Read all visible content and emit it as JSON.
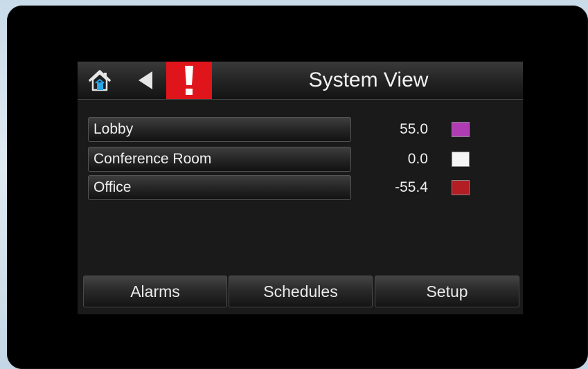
{
  "header": {
    "title": "System View",
    "home_icon": "home-icon",
    "back_icon": "back-arrow-icon",
    "alert_icon": "exclamation-alert-icon",
    "alert_color": "#e0151c"
  },
  "zones": [
    {
      "name": "Lobby",
      "value": "55.0",
      "color": "#b03cb3"
    },
    {
      "name": "Conference Room",
      "value": "0.0",
      "color": "#f5f5f5"
    },
    {
      "name": "Office",
      "value": "-55.4",
      "color": "#b31d24"
    }
  ],
  "footer": {
    "alarms_label": "Alarms",
    "schedules_label": "Schedules",
    "setup_label": "Setup"
  }
}
